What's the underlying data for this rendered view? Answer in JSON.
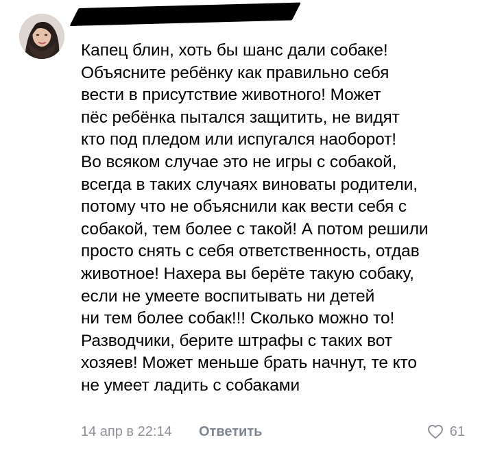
{
  "comment": {
    "avatar_icon": "user-avatar-photo",
    "author_name": "",
    "text_lines": [
      "Капец блин, хоть бы шанс дали собаке!",
      "Объясните ребёнку как правильно себя",
      "вести в присутствие животного! Может",
      "пёс ребёнка пытался защитить, не видят",
      "кто под пледом или испугался наоборот!",
      "Во всяком случае это не игры с собакой,",
      "всегда в таких случаях виноваты родители,",
      "потому что не объяснили как вести себя с",
      "собакой, тем более с такой! А потом решили",
      "просто снять с себя ответственность, отдав",
      "животное! Нахера вы берёте такую собаку,",
      "если не умеете воспитывать ни детей",
      "ни тем более собак!!! Сколько можно то!",
      "Разводчики, берите штрафы с таких вот",
      "хозяев! Может меньше брать начнут, те кто",
      "не умеет ладить с собаками"
    ],
    "date": "14 апр в 22:14",
    "reply_label": "Ответить",
    "like_icon": "heart-outline-icon",
    "likes_count": "61"
  },
  "colors": {
    "text": "#000000",
    "meta": "#8f9399",
    "reply": "#7f8590",
    "background": "#ffffff",
    "redaction": "#000000"
  }
}
